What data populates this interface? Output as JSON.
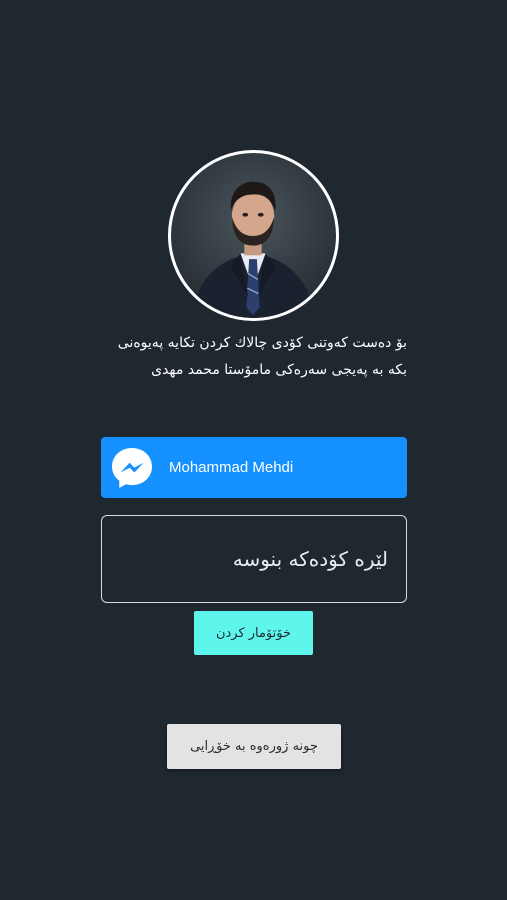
{
  "profile": {
    "avatar_icon": "person-photo",
    "instructions": "بۆ دەست کەوتنی کۆدی چالاك کردن تکایە پەیوەنی بکە بە پەیجی سەرەکی مامۆستا محمد مهدی"
  },
  "messenger": {
    "label": "Mohammad Mehdi",
    "icon": "messenger-icon",
    "color": "#1591ff"
  },
  "code_field": {
    "placeholder": "لێرە کۆدەکە بنوسە",
    "value": ""
  },
  "buttons": {
    "register_label": "خۆتۆمار کردن",
    "back_label": "چونە ژورەوە بە خۆڕایی"
  },
  "colors": {
    "background": "#1f272f",
    "accent": "#5ef6ec"
  }
}
